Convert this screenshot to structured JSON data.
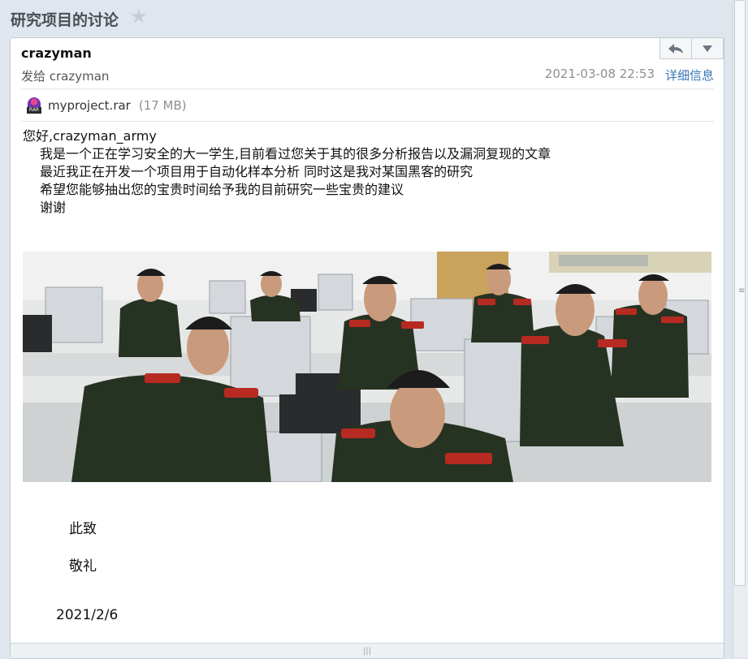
{
  "header": {
    "subject": "研究项目的讨论",
    "star_icon": "star-icon"
  },
  "message": {
    "sender": "crazyman",
    "recipient": "发给 crazyman",
    "date": "2021-03-08 22:53",
    "details_link": "详细信息",
    "actions": [
      "reply-icon",
      "dropdown-icon"
    ]
  },
  "attachment": {
    "icon": "rar-icon",
    "icon_tag": "RAR",
    "name": "myproject.rar",
    "size": "(17 MB)"
  },
  "body": {
    "greeting": "您好,crazyman_army",
    "lines": [
      "我是一个正在学习安全的大一学生,目前看过您关于其的很多分析报告以及漏洞复现的文章",
      "最近我正在开发一个项目用于自动化样本分析 同时这是我对某国黑客的研究",
      "希望您能够抽出您的宝贵时间给予我的目前研究一些宝贵的建议",
      "谢谢"
    ],
    "closing_1": "此致",
    "closing_2": "敬礼",
    "sign_date": "2021/2/6"
  },
  "colors": {
    "link": "#3a74b6",
    "muted": "#8b9096",
    "background": "#dfe6ee"
  }
}
